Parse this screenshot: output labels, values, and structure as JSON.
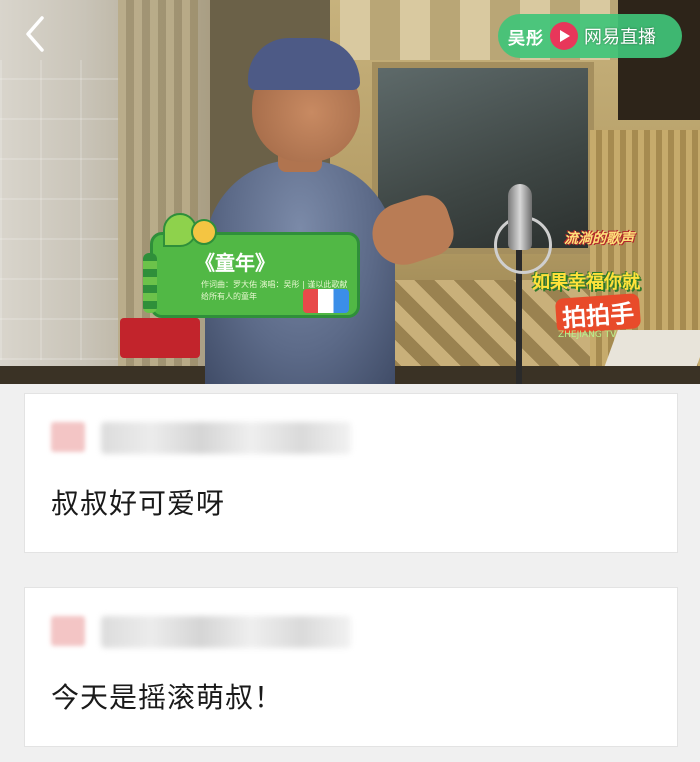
{
  "header": {
    "back_icon": "chevron-left-icon",
    "logo": {
      "left_text": "吴彤",
      "right_text": "网易直播",
      "play_icon": "play-circle-icon",
      "badge_color": "#40c478"
    }
  },
  "video": {
    "song_card": {
      "title": "《童年》",
      "credits": "作词曲：罗大佑 演唱：吴彤 | 谨以此歌献给所有人的童年"
    },
    "show_logo": {
      "name": "流淌的歌声",
      "slogan": "如果幸福你就",
      "clap": "拍拍手",
      "tagline": "ZHEJIANG TV"
    }
  },
  "comments": [
    {
      "text": "叔叔好可爱呀"
    },
    {
      "text": "今天是摇滚萌叔！"
    }
  ]
}
